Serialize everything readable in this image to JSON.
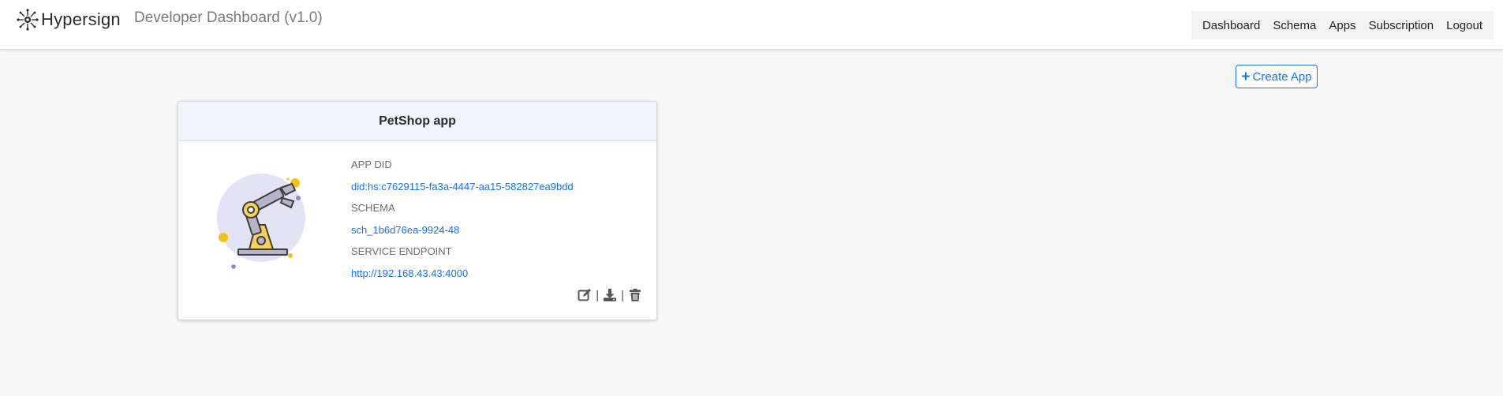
{
  "header": {
    "brand_name": "Hypersign",
    "app_title": "Developer Dashboard (v1.0)"
  },
  "nav": {
    "items": [
      "Dashboard",
      "Schema",
      "Apps",
      "Subscription",
      "Logout"
    ]
  },
  "toolbar": {
    "create_label": "Create App"
  },
  "app_card": {
    "title": "PetShop app",
    "app_did_label": "APP DID",
    "app_did_value": "did:hs:c7629115-fa3a-4447-aa15-582827ea9bdd",
    "schema_label": "SCHEMA",
    "schema_value": "sch_1b6d76ea-9924-48",
    "endpoint_label": "SERVICE ENDPOINT",
    "endpoint_value": "http://192.168.43.43:4000"
  },
  "colors": {
    "accent": "#1a73e8",
    "card_header_bg": "#eef5fc",
    "page_bg": "#f8f8f8"
  },
  "icons": [
    "hypersign-logo-icon",
    "plus-icon",
    "robot-arm-illustration",
    "edit-icon",
    "download-icon",
    "trash-icon"
  ]
}
